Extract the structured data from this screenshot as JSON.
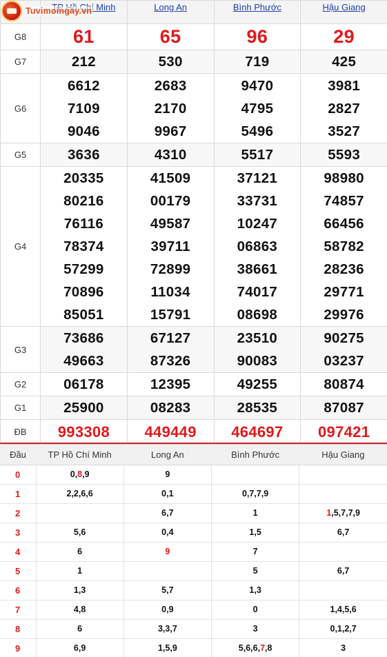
{
  "logo": {
    "text": "Tuvimoingay.vn"
  },
  "provinces": [
    "TP Hồ Chí Minh",
    "Long An",
    "Bình Phước",
    "Hậu Giang"
  ],
  "prizes": [
    {
      "label": "G8",
      "values": [
        [
          "61"
        ],
        [
          "65"
        ],
        [
          "96"
        ],
        [
          "29"
        ]
      ]
    },
    {
      "label": "G7",
      "values": [
        [
          "212"
        ],
        [
          "530"
        ],
        [
          "719"
        ],
        [
          "425"
        ]
      ]
    },
    {
      "label": "G6",
      "values": [
        [
          "6612",
          "7109",
          "9046"
        ],
        [
          "2683",
          "2170",
          "9967"
        ],
        [
          "9470",
          "4795",
          "5496"
        ],
        [
          "3981",
          "2827",
          "3527"
        ]
      ]
    },
    {
      "label": "G5",
      "values": [
        [
          "3636"
        ],
        [
          "4310"
        ],
        [
          "5517"
        ],
        [
          "5593"
        ]
      ]
    },
    {
      "label": "G4",
      "values": [
        [
          "20335",
          "80216",
          "76116",
          "78374",
          "57299",
          "70896",
          "85051"
        ],
        [
          "41509",
          "00179",
          "49587",
          "39711",
          "72899",
          "11034",
          "15791"
        ],
        [
          "37121",
          "33731",
          "10247",
          "06863",
          "38661",
          "74017",
          "08698"
        ],
        [
          "98980",
          "74857",
          "66456",
          "58782",
          "28236",
          "29771",
          "29976"
        ]
      ]
    },
    {
      "label": "G3",
      "values": [
        [
          "73686",
          "49663"
        ],
        [
          "67127",
          "87326"
        ],
        [
          "23510",
          "90083"
        ],
        [
          "90275",
          "03237"
        ]
      ]
    },
    {
      "label": "G2",
      "values": [
        [
          "06178"
        ],
        [
          "12395"
        ],
        [
          "49255"
        ],
        [
          "80874"
        ]
      ]
    },
    {
      "label": "G1",
      "values": [
        [
          "25900"
        ],
        [
          "08283"
        ],
        [
          "28535"
        ],
        [
          "87087"
        ]
      ]
    },
    {
      "label": "ĐB",
      "values": [
        [
          "993308"
        ],
        [
          "449449"
        ],
        [
          "464697"
        ],
        [
          "097421"
        ]
      ]
    }
  ],
  "loto": {
    "headers": [
      "Đầu",
      "TP Hồ Chí Minh",
      "Long An",
      "Bình Phước",
      "Hậu Giang"
    ],
    "rows": [
      {
        "dau": "0",
        "cells": [
          [
            [
              "0,",
              false
            ],
            [
              "8",
              true
            ],
            [
              ",9",
              false
            ]
          ],
          [
            [
              "9",
              false
            ]
          ],
          [],
          []
        ]
      },
      {
        "dau": "1",
        "cells": [
          [
            [
              "2,2,6,6",
              false
            ]
          ],
          [
            [
              "0,1",
              false
            ]
          ],
          [
            [
              "0,7,7,9",
              false
            ]
          ],
          []
        ]
      },
      {
        "dau": "2",
        "cells": [
          [],
          [
            [
              "6,7",
              false
            ]
          ],
          [
            [
              "1",
              false
            ]
          ],
          [
            [
              "1",
              true
            ],
            [
              ",5,7,7,9",
              false
            ]
          ]
        ]
      },
      {
        "dau": "3",
        "cells": [
          [
            [
              "5,6",
              false
            ]
          ],
          [
            [
              "0,4",
              false
            ]
          ],
          [
            [
              "1,5",
              false
            ]
          ],
          [
            [
              "6,7",
              false
            ]
          ]
        ]
      },
      {
        "dau": "4",
        "cells": [
          [
            [
              "6",
              false
            ]
          ],
          [
            [
              "9",
              true
            ]
          ],
          [
            [
              "7",
              false
            ]
          ],
          []
        ]
      },
      {
        "dau": "5",
        "cells": [
          [
            [
              "1",
              false
            ]
          ],
          [],
          [
            [
              "5",
              false
            ]
          ],
          [
            [
              "6,7",
              false
            ]
          ]
        ]
      },
      {
        "dau": "6",
        "cells": [
          [
            [
              "1,3",
              false
            ]
          ],
          [
            [
              "5,7",
              false
            ]
          ],
          [
            [
              "1,3",
              false
            ]
          ],
          []
        ]
      },
      {
        "dau": "7",
        "cells": [
          [
            [
              "4,8",
              false
            ]
          ],
          [
            [
              "0,9",
              false
            ]
          ],
          [
            [
              "0",
              false
            ]
          ],
          [
            [
              "1,4,5,6",
              false
            ]
          ]
        ]
      },
      {
        "dau": "8",
        "cells": [
          [
            [
              "6",
              false
            ]
          ],
          [
            [
              "3,3,7",
              false
            ]
          ],
          [
            [
              "3",
              false
            ]
          ],
          [
            [
              "0,1,2,7",
              false
            ]
          ]
        ]
      },
      {
        "dau": "9",
        "cells": [
          [
            [
              "6,9",
              false
            ]
          ],
          [
            [
              "1,5,9",
              false
            ]
          ],
          [
            [
              "5,6,6,",
              false
            ],
            [
              "7",
              true
            ],
            [
              ",8",
              false
            ]
          ],
          [
            [
              "3",
              false
            ]
          ]
        ]
      }
    ]
  },
  "colors": {
    "accent_red": "#e0191b",
    "link_blue": "#1a3ea8",
    "logo_orange": "#e84b16"
  }
}
